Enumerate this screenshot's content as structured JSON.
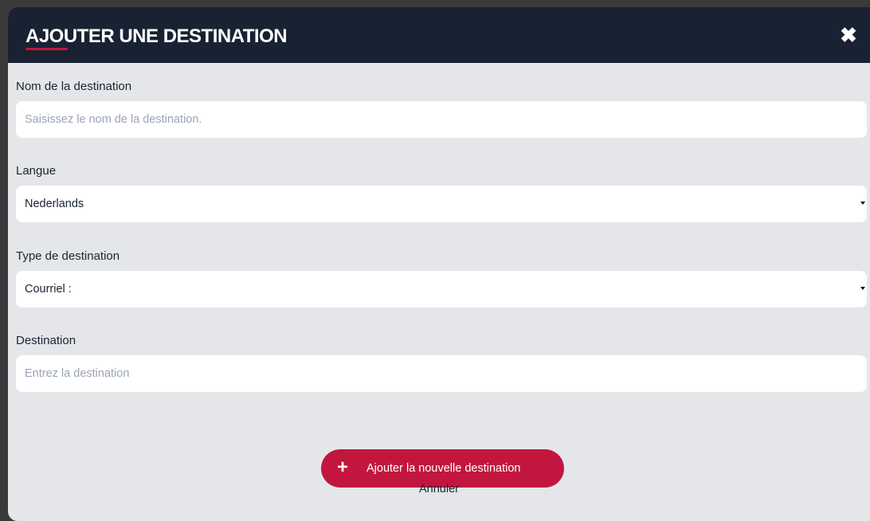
{
  "modal": {
    "title": "AJOUTER UNE DESTINATION",
    "close_icon": "close-icon",
    "close_glyph": "✖"
  },
  "form": {
    "name": {
      "label": "Nom de la destination",
      "placeholder": "Saisissez le nom de la destination.",
      "value": ""
    },
    "language": {
      "label": "Langue",
      "selected": "Nederlands",
      "icon": "chevron-down-icon"
    },
    "type": {
      "label": "Type de destination",
      "selected": "Courriel :",
      "icon": "chevron-down-icon"
    },
    "destination": {
      "label": "Destination",
      "placeholder": "Entrez la destination",
      "value": ""
    }
  },
  "actions": {
    "add_label": "Ajouter la nouvelle destination",
    "add_icon": "plus-icon",
    "add_glyph": "+",
    "cancel_label": "Annuler"
  },
  "colors": {
    "header": "#182233",
    "accent": "#c3163e",
    "background": "#e5e6ea",
    "placeholder": "#9aa4b7"
  }
}
